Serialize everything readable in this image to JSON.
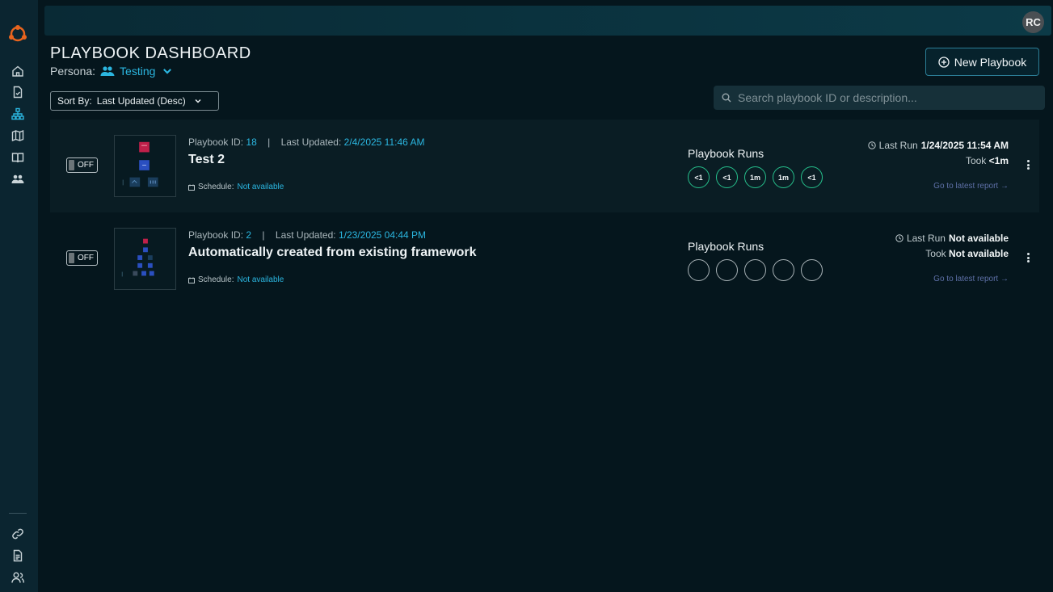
{
  "user": {
    "initials": "RC"
  },
  "header": {
    "title": "PLAYBOOK DASHBOARD",
    "persona_label": "Persona:",
    "persona_value": "Testing",
    "new_button": "New Playbook"
  },
  "sort": {
    "label": "Sort By:",
    "value": "Last Updated (Desc)"
  },
  "search": {
    "placeholder": "Search playbook ID or description..."
  },
  "sidebar": {
    "items": [
      {
        "icon": "home-icon"
      },
      {
        "icon": "report-icon"
      },
      {
        "icon": "playbooks-icon",
        "active": true
      },
      {
        "icon": "map-icon"
      },
      {
        "icon": "book-icon"
      },
      {
        "icon": "users-icon"
      }
    ],
    "bottom": [
      {
        "icon": "link-icon"
      },
      {
        "icon": "document-icon"
      },
      {
        "icon": "user-manage-icon"
      }
    ]
  },
  "playbooks": [
    {
      "toggle": "OFF",
      "id_label": "Playbook ID:",
      "id": "18",
      "updated_label": "Last Updated:",
      "updated": "2/4/2025 11:46 AM",
      "title": "Test 2",
      "schedule_label": "Schedule:",
      "schedule": "Not available",
      "runs_label": "Playbook Runs",
      "runs": [
        "<1",
        "<1",
        "1m",
        "1m",
        "<1"
      ],
      "last_run_label": "Last Run",
      "last_run": "1/24/2025 11:54 AM",
      "took_label": "Took",
      "took": "<1m",
      "report_link": "Go to latest report →"
    },
    {
      "toggle": "OFF",
      "id_label": "Playbook ID:",
      "id": "2",
      "updated_label": "Last Updated:",
      "updated": "1/23/2025 04:44 PM",
      "title": "Automatically created from existing framework",
      "schedule_label": "Schedule:",
      "schedule": "Not available",
      "runs_label": "Playbook Runs",
      "runs": [
        "",
        "",
        "",
        "",
        ""
      ],
      "last_run_label": "Last Run",
      "last_run": "Not available",
      "took_label": "Took",
      "took": "Not available",
      "report_link": "Go to latest report →"
    }
  ]
}
